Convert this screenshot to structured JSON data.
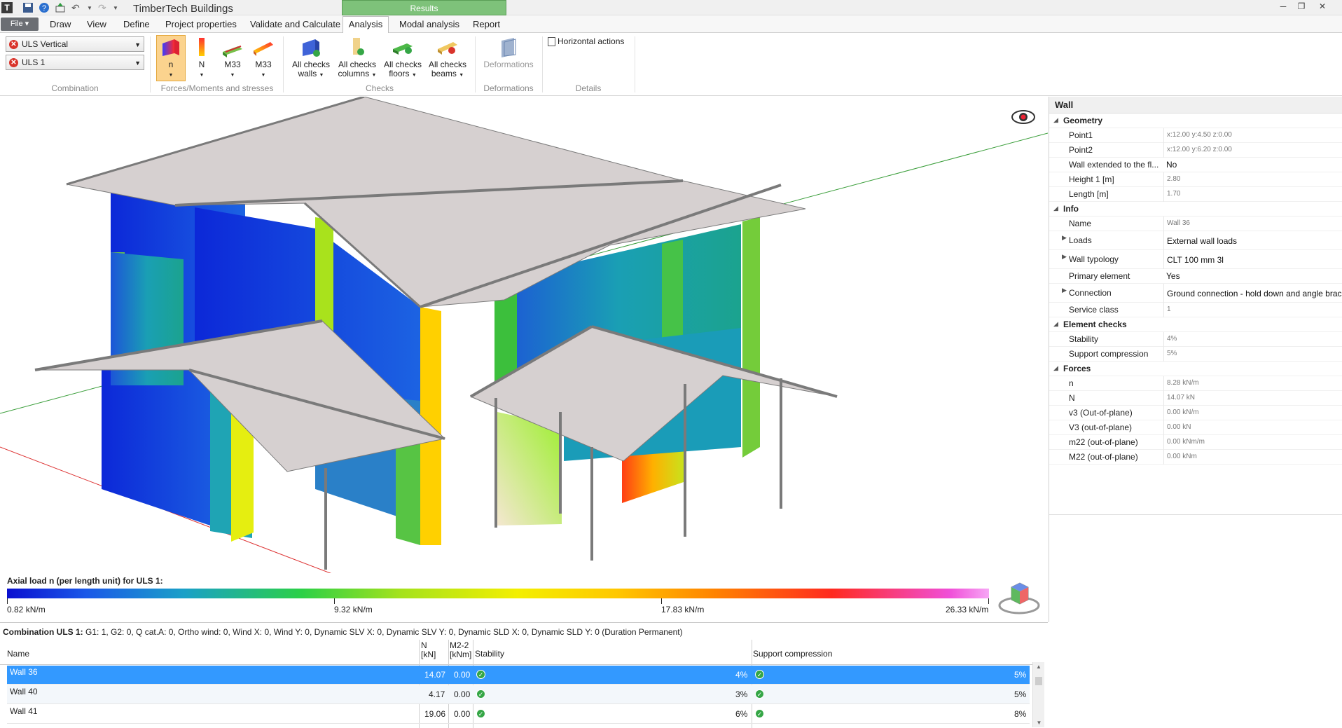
{
  "app": {
    "title": "TimberTech Buildings",
    "context_tab": "Results"
  },
  "menu": {
    "file": "File",
    "tabs": [
      "Draw",
      "View",
      "Define",
      "Project properties",
      "Validate and Calculate",
      "Analysis",
      "Modal analysis",
      "Report"
    ]
  },
  "ribbon": {
    "combination": {
      "selected_combo": "ULS Vertical",
      "selected_case": "ULS 1",
      "group_label": "Combination"
    },
    "forces": {
      "group_label": "Forces/Moments and stresses",
      "buttons": [
        "n",
        "N",
        "M33",
        "M33"
      ]
    },
    "checks": {
      "group_label": "Checks",
      "buttons": [
        "All checks walls",
        "All checks columns",
        "All checks floors",
        "All checks beams"
      ],
      "lines": [
        [
          "All checks",
          "walls"
        ],
        [
          "All checks",
          "columns"
        ],
        [
          "All checks",
          "floors"
        ],
        [
          "All checks",
          "beams"
        ]
      ]
    },
    "deformations": {
      "group_label": "Deformations",
      "button": "Deformations"
    },
    "details": {
      "group_label": "Details",
      "button": "Horizontal actions"
    }
  },
  "legend": {
    "title": "Axial load n (per length unit) for ULS 1:",
    "ticks": [
      "0.82 kN/m",
      "9.32 kN/m",
      "17.83 kN/m",
      "26.33 kN/m"
    ]
  },
  "properties": {
    "header": "Wall",
    "geometry": {
      "label": "Geometry",
      "point1_label": "Point1",
      "point1": "x:12.00 y:4.50 z:0.00",
      "point2_label": "Point2",
      "point2": "x:12.00 y:6.20 z:0.00",
      "extended_label": "Wall extended to the fl...",
      "extended": "No",
      "height_label": "Height 1 [m]",
      "height": "2.80",
      "length_label": "Length [m]",
      "length": "1.70"
    },
    "info": {
      "label": "Info",
      "name_label": "Name",
      "name": "Wall 36",
      "loads_label": "Loads",
      "loads": "External wall loads",
      "typology_label": "Wall typology",
      "typology": "CLT 100 mm 3l",
      "primary_label": "Primary element",
      "primary": "Yes",
      "connection_label": "Connection",
      "connection": "Ground connection - hold down and angle brac",
      "service_label": "Service class",
      "service": "1"
    },
    "checks": {
      "label": "Element checks",
      "stability_label": "Stability",
      "stability": "4%",
      "support_label": "Support compression",
      "support": "5%"
    },
    "forces": {
      "label": "Forces",
      "n_label": "n",
      "n": "8.28 kN/m",
      "N_label": "N",
      "N": "14.07 kN",
      "v3_label": "v3 (Out-of-plane)",
      "v3": "0.00 kN/m",
      "V3_label": "V3 (out-of-plane)",
      "V3": "0.00 kN",
      "m22_label": "m22 (out-of-plane)",
      "m22": "0.00 kNm/m",
      "M22_label": "M22 (out-of-plane)",
      "M22": "0.00 kNm"
    }
  },
  "results": {
    "combo_label": "Combination ULS 1:",
    "combo_desc": "G1: 1, G2: 0, Q cat.A: 0, Ortho wind: 0, Wind X: 0, Wind Y: 0, Dynamic SLV X: 0, Dynamic SLV Y: 0, Dynamic SLD X: 0, Dynamic SLD Y: 0 (Duration Permanent)",
    "headers": {
      "name": "Name",
      "n1": "N",
      "n2": "[kN]",
      "m1": "M2-2",
      "m2": "[kNm]",
      "stability": "Stability",
      "support": "Support compression"
    },
    "rows": [
      {
        "name": "Wall 36",
        "N": "14.07",
        "M": "0.00",
        "stability": "4%",
        "support": "5%"
      },
      {
        "name": "Wall 40",
        "N": "4.17",
        "M": "0.00",
        "stability": "3%",
        "support": "5%"
      },
      {
        "name": "Wall 41",
        "N": "19.06",
        "M": "0.00",
        "stability": "6%",
        "support": "8%"
      }
    ]
  }
}
